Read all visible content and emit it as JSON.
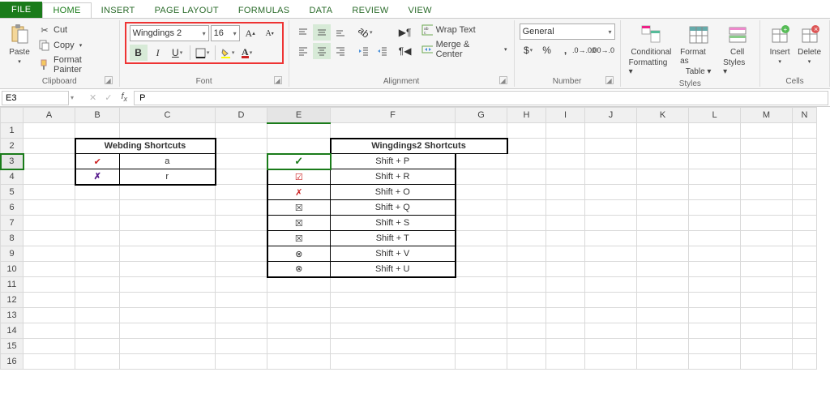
{
  "tabs": {
    "file": "FILE",
    "home": "HOME",
    "insert": "INSERT",
    "page": "PAGE LAYOUT",
    "formulas": "FORMULAS",
    "data": "DATA",
    "review": "REVIEW",
    "view": "VIEW"
  },
  "clipboard": {
    "paste": "Paste",
    "cut": "Cut",
    "copy": "Copy",
    "fp": "Format Painter",
    "label": "Clipboard"
  },
  "font": {
    "name": "Wingdings 2",
    "size": "16",
    "label": "Font"
  },
  "alignment": {
    "wrap": "Wrap Text",
    "merge": "Merge & Center",
    "label": "Alignment"
  },
  "number": {
    "format": "General",
    "label": "Number"
  },
  "styles": {
    "cf": "Conditional",
    "cf2": "Formatting",
    "ft": "Format as",
    "ft2": "Table",
    "cs": "Cell",
    "cs2": "Styles",
    "label": "Styles"
  },
  "cells": {
    "ins": "Insert",
    "del": "Delete",
    "label": "Cells"
  },
  "namebox": "E3",
  "formula": "P",
  "cols": [
    "A",
    "B",
    "C",
    "D",
    "E",
    "F",
    "G",
    "H",
    "I",
    "J",
    "K",
    "L",
    "M",
    "N"
  ],
  "table1": {
    "header": "Webding Shortcuts",
    "rows": [
      {
        "sym": "✔",
        "symClass": "red",
        "key": "a"
      },
      {
        "sym": "✗",
        "symClass": "purp",
        "key": "r"
      }
    ]
  },
  "table2": {
    "header": "Wingdings2 Shortcuts",
    "rows": [
      {
        "sym": "✓",
        "symClass": "chk",
        "key": "Shift + P"
      },
      {
        "sym": "☑",
        "symClass": "red",
        "key": "Shift + R"
      },
      {
        "sym": "✗",
        "symClass": "red",
        "key": "Shift + O"
      },
      {
        "sym": "☒",
        "symClass": "",
        "key": "Shift + Q"
      },
      {
        "sym": "☒",
        "symClass": "",
        "key": "Shift + S"
      },
      {
        "sym": "☒",
        "symClass": "",
        "key": "Shift + T"
      },
      {
        "sym": "⊗",
        "symClass": "",
        "key": "Shift + V"
      },
      {
        "sym": "⊗",
        "symClass": "",
        "key": "Shift + U"
      }
    ]
  }
}
